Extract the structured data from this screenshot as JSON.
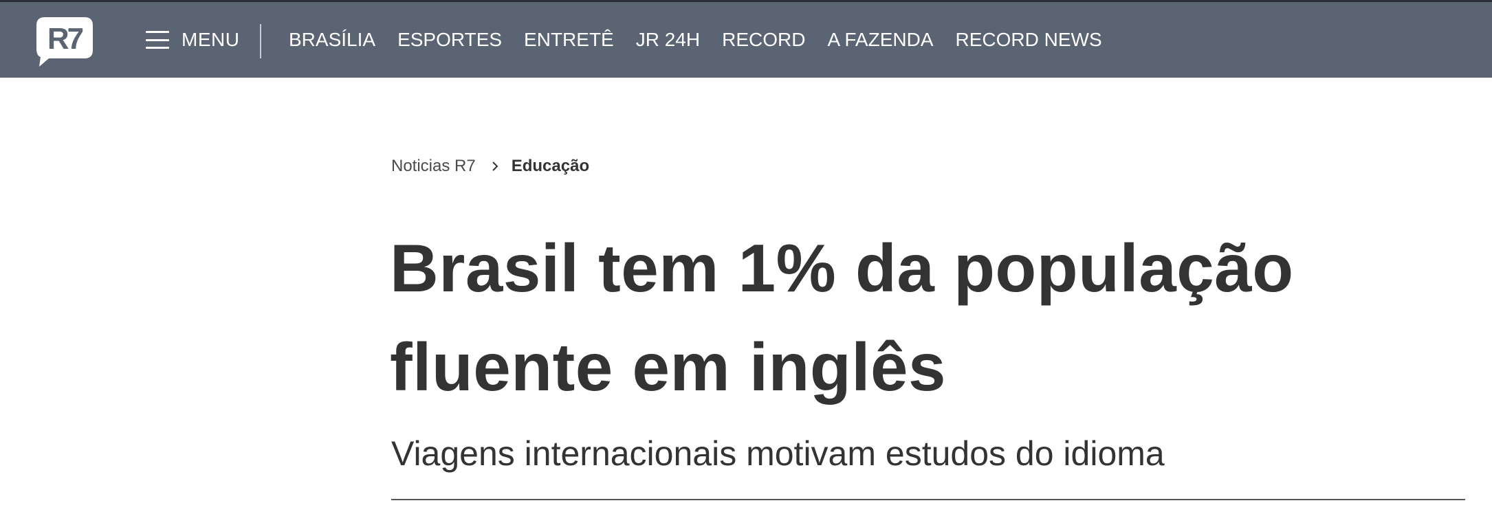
{
  "header": {
    "logo_text": "R7",
    "menu_label": "MENU",
    "nav_items": [
      "BRASÍLIA",
      "ESPORTES",
      "ENTRETÊ",
      "JR 24H",
      "RECORD",
      "A FAZENDA",
      "RECORD NEWS"
    ],
    "background_color": "#5a6472"
  },
  "breadcrumb": {
    "root": "Noticias R7",
    "separator_icon": "chevron-right-icon",
    "current": "Educação"
  },
  "article": {
    "headline": "Brasil tem 1% da população fluente em inglês",
    "subtitle": "Viagens internacionais motivam estudos do idioma"
  }
}
